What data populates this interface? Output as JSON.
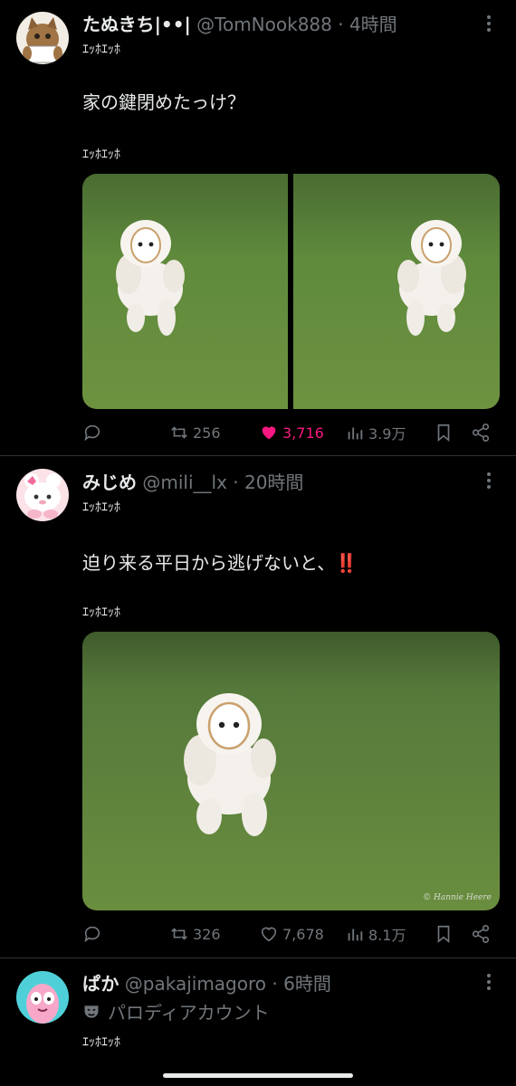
{
  "tweets": [
    {
      "name": "たぬきち|••|",
      "handle": "@TomNook888",
      "sep": "·",
      "time": "4時間",
      "subtitle": "ｴｯﾎｴｯﾎ",
      "text": "家の鍵閉めたっけ？",
      "text2": "ｴｯﾎｴｯﾎ",
      "stats": {
        "retweets": "256",
        "likes": "3,716",
        "views": "3.9万"
      },
      "liked": true,
      "like_color": "#f91880"
    },
    {
      "name": "みじめ",
      "handle": "@mili__lx",
      "sep": "·",
      "time": "20時間",
      "subtitle": "ｴｯﾎｴｯﾎ",
      "text": "迫り来る平日から逃げないと、‼️",
      "text2": "ｴｯﾎｴｯﾎ",
      "watermark": "© Hannie Heere",
      "stats": {
        "retweets": "326",
        "likes": "7,678",
        "views": "8.1万"
      },
      "liked": false
    },
    {
      "name": "ぱか",
      "handle": "@pakajimagoro",
      "sep": "·",
      "time": "6時間",
      "parody_label": "パロディアカウント",
      "subtitle": "ｴｯﾎｴｯﾎ"
    }
  ],
  "icons": {
    "reply": "reply-icon",
    "retweet": "retweet-icon",
    "like": "heart-icon",
    "views": "views-icon",
    "bookmark": "bookmark-icon",
    "share": "share-icon",
    "more": "more-icon",
    "parody": "mask-icon"
  },
  "colors": {
    "background": "#000000",
    "text": "#e7e9ea",
    "muted": "#71767b",
    "like": "#f91880"
  }
}
